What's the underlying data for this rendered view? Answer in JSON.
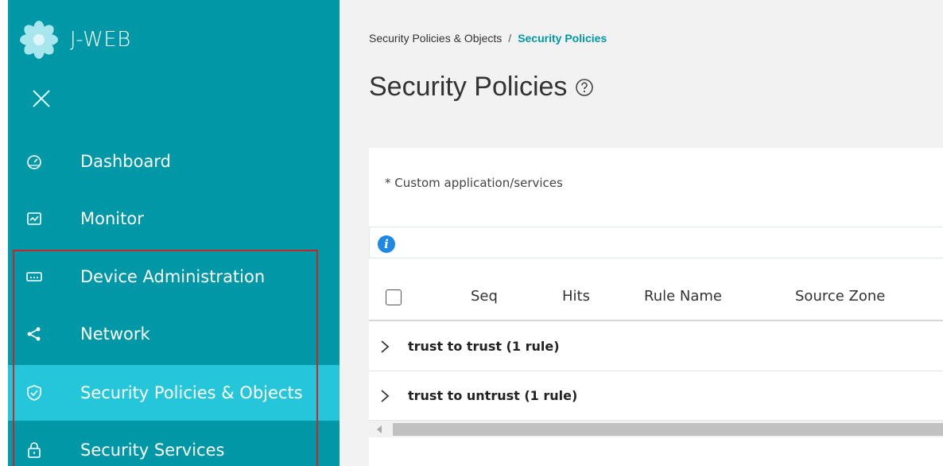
{
  "app": {
    "name": "J-WEB",
    "brand_color": "#0097a7",
    "active_color": "#26c6da"
  },
  "sidebar": {
    "close_icon": "close-icon",
    "items": [
      {
        "label": "Dashboard",
        "icon": "dashboard-gauge-icon",
        "active": false
      },
      {
        "label": "Monitor",
        "icon": "monitor-chart-icon",
        "active": false
      },
      {
        "label": "Device Administration",
        "icon": "device-admin-icon",
        "active": false
      },
      {
        "label": "Network",
        "icon": "network-share-icon",
        "active": false
      },
      {
        "label": "Security Policies & Objects",
        "icon": "shield-check-icon",
        "active": true
      },
      {
        "label": "Security Services",
        "icon": "lock-icon",
        "active": false
      }
    ]
  },
  "main": {
    "breadcrumb": {
      "parent": "Security Policies & Objects",
      "separator": "/",
      "current": "Security Policies"
    },
    "title": "Security Policies",
    "note": "* Custom application/services",
    "table": {
      "columns": [
        "Seq",
        "Hits",
        "Rule Name",
        "Source Zone"
      ],
      "groups": [
        {
          "label": "trust to trust (1 rule)"
        },
        {
          "label": "trust to untrust (1 rule)"
        }
      ]
    }
  }
}
